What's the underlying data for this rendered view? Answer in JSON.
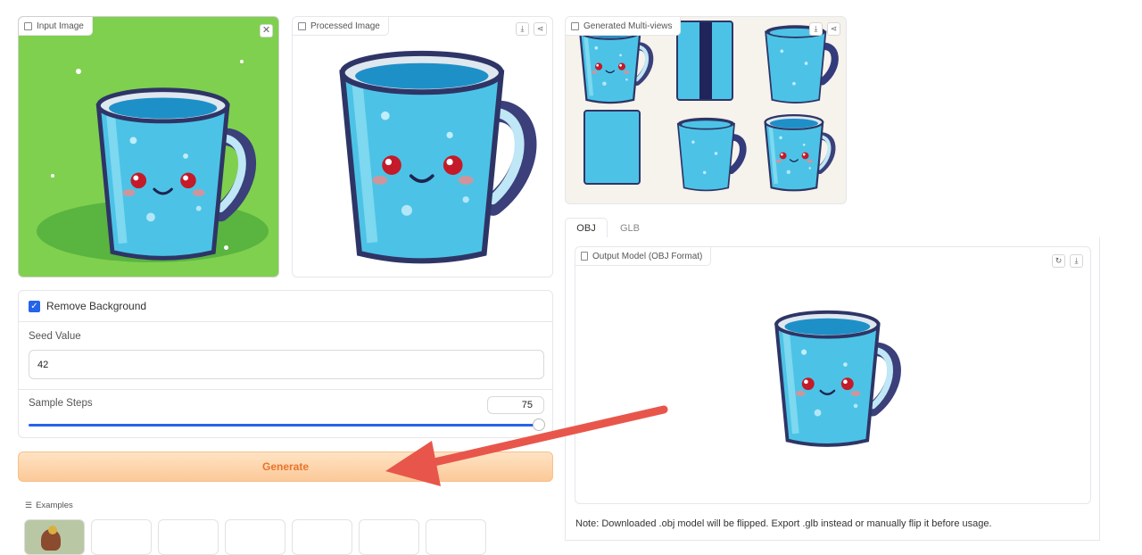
{
  "input_panel": {
    "label": "Input Image"
  },
  "processed_panel": {
    "label": "Processed Image"
  },
  "multiview_panel": {
    "label": "Generated Multi-views"
  },
  "options": {
    "remove_bg_label": "Remove Background",
    "remove_bg_checked": true,
    "seed_label": "Seed Value",
    "seed_value": "42",
    "steps_label": "Sample Steps",
    "steps_value": "75",
    "steps_fraction": 1.0
  },
  "generate_label": "Generate",
  "examples_label": "Examples",
  "tabs": [
    {
      "label": "OBJ",
      "active": true
    },
    {
      "label": "GLB",
      "active": false
    }
  ],
  "output": {
    "label": "Output Model (OBJ Format)",
    "note": "Note: Downloaded .obj model will be flipped. Export .glb instead or manually flip it before usage."
  },
  "colors": {
    "accent": "#2563eb",
    "generate_bg": "#fdd5a8",
    "generate_text": "#e8742c",
    "input_bg": "#7fd04e",
    "arrow": "#e8564b"
  },
  "icons": {
    "close": "close-icon",
    "download": "download-icon",
    "share": "share-icon",
    "reset": "reset-icon",
    "image": "image-icon",
    "file": "file-icon",
    "list": "list-icon",
    "check": "check-icon"
  }
}
